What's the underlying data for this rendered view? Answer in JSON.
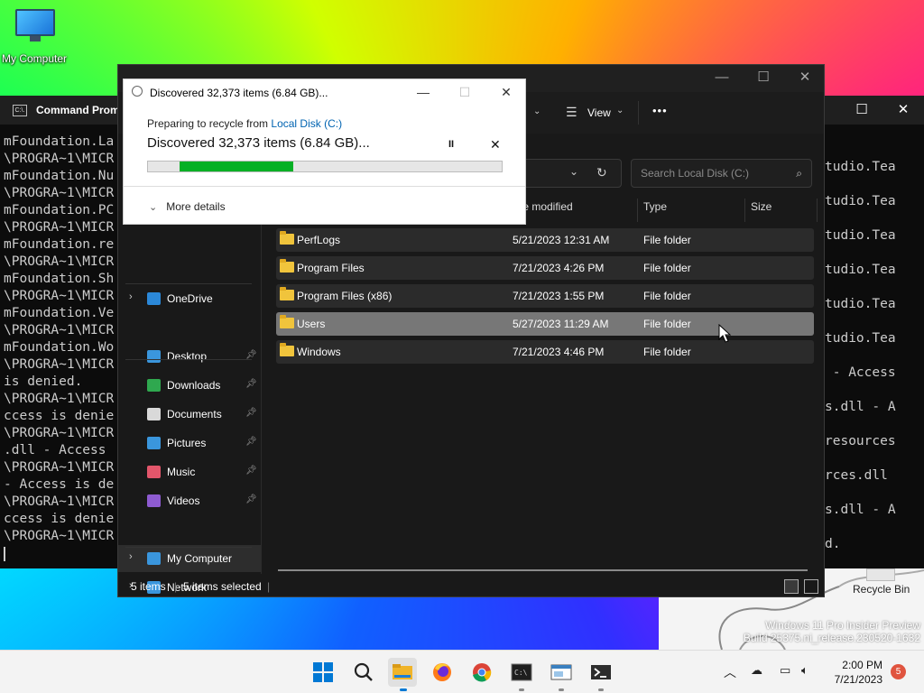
{
  "desktop": {
    "my_computer_label": "My Computer",
    "recycle_bin_label": "Recycle Bin",
    "watermark_line1": "Windows 11 Pro Insider Preview",
    "watermark_line2": "Build 25375.ni_release.230520-1632"
  },
  "cmd": {
    "title": "Command Prompt",
    "icon_text": "C:\\.",
    "lines": [
      "mFoundation.La",
      "\\PROGRA~1\\MICR",
      "mFoundation.Nu",
      "\\PROGRA~1\\MICR",
      "mFoundation.PC",
      "\\PROGRA~1\\MICR",
      "mFoundation.re",
      "\\PROGRA~1\\MICR",
      "mFoundation.Sh",
      "\\PROGRA~1\\MICR",
      "mFoundation.Ve",
      "\\PROGRA~1\\MICR",
      "mFoundation.Wo",
      "\\PROGRA~1\\MICR",
      "is denied.",
      "\\PROGRA~1\\MICR",
      "ccess is denie",
      "\\PROGRA~1\\MICR",
      ".dll - Access",
      "\\PROGRA~1\\MICR",
      "- Access is de",
      "\\PROGRA~1\\MICR",
      "ccess is denie",
      "\\PROGRA~1\\MICR"
    ],
    "right_lines": [
      "tudio.Tea",
      "tudio.Tea",
      "tudio.Tea",
      "tudio.Tea",
      "tudio.Tea",
      "tudio.Tea",
      " - Access",
      "s.dll - A",
      "resources",
      "rces.dll",
      "s.dll - A",
      "d."
    ]
  },
  "explorer": {
    "toolbar": {
      "view_label": "View",
      "more_label": "•••"
    },
    "search_placeholder": "Search Local Disk (C:)",
    "columns": {
      "date": "te modified",
      "type": "Type",
      "size": "Size"
    },
    "sidebar": [
      {
        "label": "OneDrive",
        "icon": "cloud-icon",
        "chevron": true
      },
      {
        "label": "Desktop",
        "icon": "desktop-icon",
        "pinned": true
      },
      {
        "label": "Downloads",
        "icon": "download-icon",
        "pinned": true
      },
      {
        "label": "Documents",
        "icon": "document-icon",
        "pinned": true
      },
      {
        "label": "Pictures",
        "icon": "picture-icon",
        "pinned": true
      },
      {
        "label": "Music",
        "icon": "music-icon",
        "pinned": true
      },
      {
        "label": "Videos",
        "icon": "video-icon",
        "pinned": true
      },
      {
        "label": "My Computer",
        "icon": "computer-icon",
        "chevron": true,
        "selected": true
      },
      {
        "label": "Network",
        "icon": "network-icon",
        "chevron": true
      }
    ],
    "rows": [
      {
        "name": "PerfLogs",
        "date": "5/21/2023 12:31 AM",
        "type": "File folder",
        "selected": false
      },
      {
        "name": "Program Files",
        "date": "7/21/2023 4:26 PM",
        "type": "File folder",
        "selected": false
      },
      {
        "name": "Program Files (x86)",
        "date": "7/21/2023 1:55 PM",
        "type": "File folder",
        "selected": false
      },
      {
        "name": "Users",
        "date": "5/27/2023 11:29 AM",
        "type": "File folder",
        "selected": true
      },
      {
        "name": "Windows",
        "date": "7/21/2023 4:46 PM",
        "type": "File folder",
        "selected": false
      }
    ],
    "status": {
      "items": "5 items",
      "selected": "5 items selected"
    }
  },
  "dialog": {
    "title": "Discovered 32,373 items (6.84 GB)...",
    "subtitle_prefix": "Preparing to recycle from ",
    "subtitle_link": "Local Disk (C:)",
    "headline": "Discovered 32,373 items (6.84 GB)...",
    "progress": {
      "start": 0.09,
      "end": 0.41
    },
    "pause_glyph": "II",
    "cancel_glyph": "✕",
    "more_details": "More details"
  },
  "taskbar": {
    "time": "2:00 PM",
    "date": "7/21/2023",
    "notification_count": "5",
    "accent": "#0078d4"
  }
}
